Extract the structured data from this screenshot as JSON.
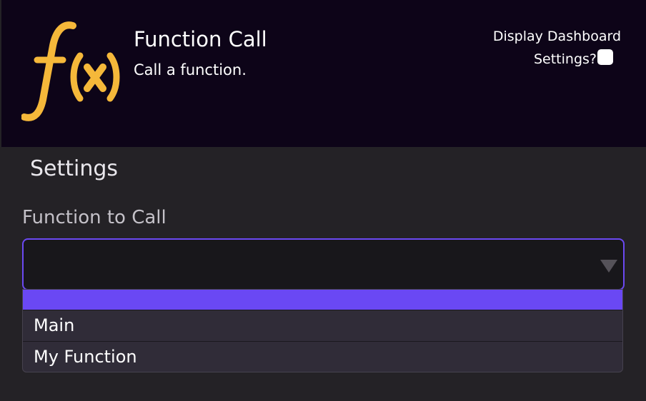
{
  "header": {
    "title": "Function Call",
    "subtitle": "Call a function.",
    "logo_icon": "function-fx-icon",
    "dashboard_label_line1": "Display Dashboard",
    "dashboard_label_line2": "Settings?",
    "dashboard_checked": false
  },
  "settings": {
    "heading": "Settings",
    "function_field": {
      "label": "Function to Call",
      "value": "",
      "options": [
        "",
        "Main",
        "My Function"
      ],
      "selected_index": 0
    }
  },
  "colors": {
    "header_bg": "#0d0418",
    "body_bg": "#242226",
    "accent": "#6a48f4",
    "logo": "#f5b83a"
  }
}
